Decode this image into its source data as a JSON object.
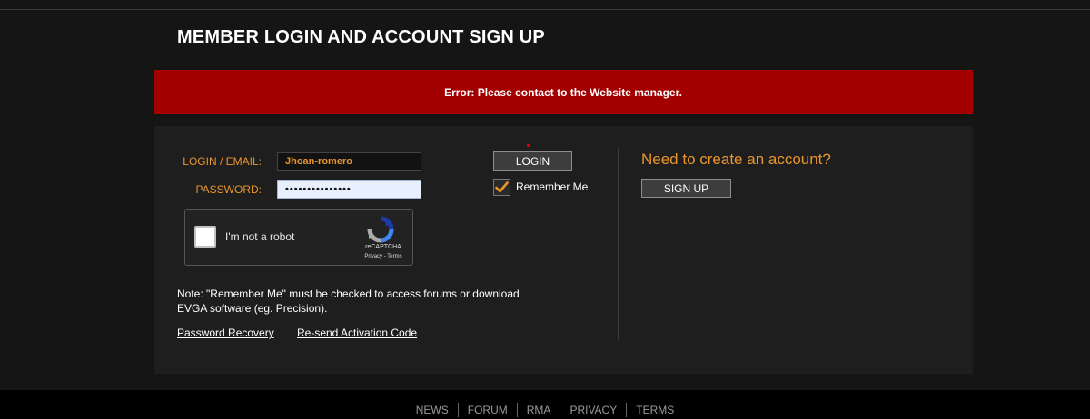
{
  "header": {
    "title": "MEMBER LOGIN AND ACCOUNT SIGN UP"
  },
  "error": {
    "message": "Error: Please contact to the Website manager."
  },
  "login_form": {
    "login_label": "LOGIN / EMAIL:",
    "login_value": "Jhoan-romero",
    "password_label": "PASSWORD:",
    "password_value": "•••••••••••••••",
    "login_button": "LOGIN",
    "remember_me_label": "Remember Me",
    "remember_me_checked": true
  },
  "captcha": {
    "label": "I'm not a robot",
    "brand": "reCAPTCHA",
    "links": "Privacy - Terms"
  },
  "note": "Note: \"Remember Me\" must be checked to access forums or download EVGA software (eg. Precision).",
  "links": {
    "password_recovery": "Password Recovery",
    "resend_activation": "Re-send Activation Code"
  },
  "signup": {
    "heading": "Need to create an account?",
    "button": "SIGN UP"
  },
  "footer": {
    "items": [
      "NEWS",
      "FORUM",
      "RMA",
      "PRIVACY",
      "TERMS"
    ]
  },
  "colors": {
    "accent_orange": "#e8952d",
    "error_red": "#a30000",
    "background": "#161516"
  }
}
